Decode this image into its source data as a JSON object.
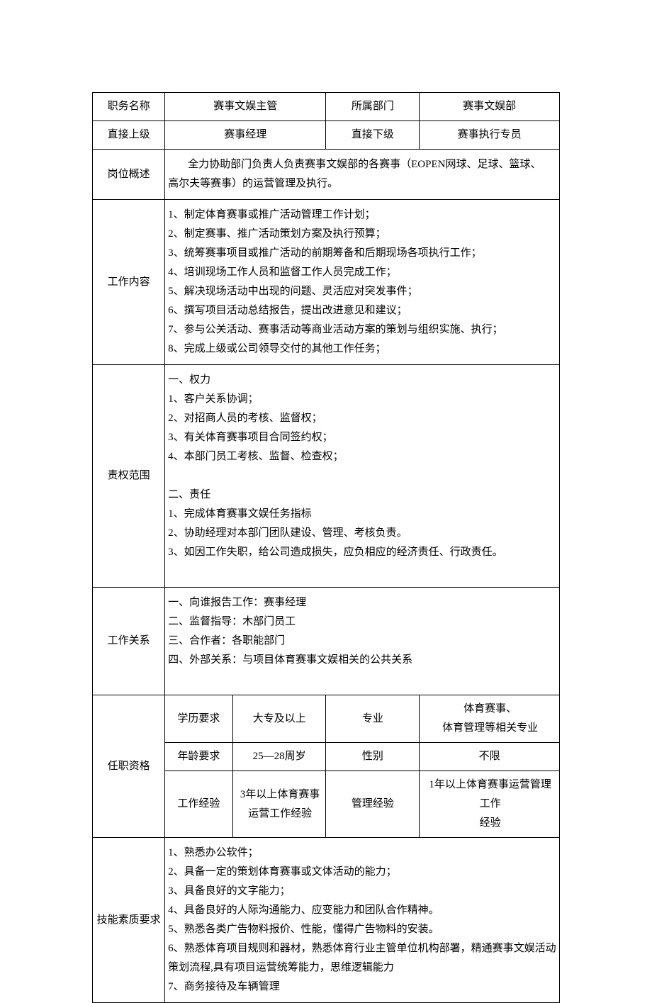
{
  "labels": {
    "jobTitle": "职务名称",
    "department": "所属部门",
    "directSuperior": "直接上级",
    "directSubordinate": "直接下级",
    "positionOverview": "岗位概述",
    "workContent": "工作内容",
    "scope": "责权范围",
    "workRelation": "工作关系",
    "qualification": "任职资格",
    "education": "学历要求",
    "major": "专业",
    "age": "年龄要求",
    "gender": "性别",
    "workExp": "工作经验",
    "mgmtExp": "管理经验",
    "skills": "技能素质要求"
  },
  "values": {
    "jobTitle": "赛事文娱主管",
    "department": "赛事文娱部",
    "directSuperior": "赛事经理",
    "directSubordinate": "赛事执行专员",
    "positionOverviewLine1": "全力协助部门负责人负责赛事文娱部的各赛事（EOPEN网球、足球、篮球、",
    "positionOverviewLine2": "高尔夫等赛事）的运营管理及执行。",
    "workContent": [
      "1、制定体育赛事或推广活动管理工作计划；",
      "2、制定赛事、推广活动策划方案及执行预算；",
      "3、统筹赛事项目或推广活动的前期筹备和后期现场各项执行工作；",
      "4、培训现场工作人员和监督工作人员完成工作；",
      "5、解决现场活动中出现的问题、灵活应对突发事件；",
      "6、撰写项目活动总结报告，提出改进意见和建议；",
      "7、参与公关活动、赛事活动等商业活动方案的策划与组织实施、执行；",
      "8、完成上级或公司领导交付的其他工作任务；"
    ],
    "scope": [
      "一、权力",
      "1、客户关系协调；",
      "2、对招商人员的考核、监督权；",
      "3、有关体育赛事项目合同签约权；",
      "4、本部门员工考核、监督、检查权；",
      "",
      "二、责任",
      "1、完成体育赛事文娱任务指标",
      "2、协助经理对本部门团队建设、管理、考核负责。",
      "3、如因工作失职，给公司造成损失，应负相应的经济责任、行政责任。",
      ""
    ],
    "workRelation": [
      "一、向谁报告工作：赛事经理",
      "二、监督指导：木部门员工",
      "三、合作者：各职能部门",
      "四、外部关系：与项目体育赛事文娱相关的公共关系",
      ""
    ],
    "education": "大专及以上",
    "majorLine1": "体育赛事、",
    "majorLine2": "体育管理等相关专业",
    "age": "25—28周岁",
    "gender": "不限",
    "workExpLine1": "3年以上体育赛事",
    "workExpLine2": "运营工作经验",
    "mgmtExpLine1": "1年以上体育赛事运营管理工作",
    "mgmtExpLine2": "经验",
    "skills": [
      "1、熟悉办公软件；",
      "2、具备一定的策划体育赛事或文体活动的能力；",
      "3、具备良好的文字能力；",
      "4、具备良好的人际沟通能力、应变能力和团队合作精神。",
      "5、熟悉各类广告物料报价、性能，懂得广告物料的安装。",
      "6、熟悉体育项目规则和器材，熟悉体育行业主管单位机构部署，精通赛事文娱活动策划流程,具有项目运营统筹能力，思维逻辑能力",
      "7、商务接待及车辆管理"
    ]
  }
}
